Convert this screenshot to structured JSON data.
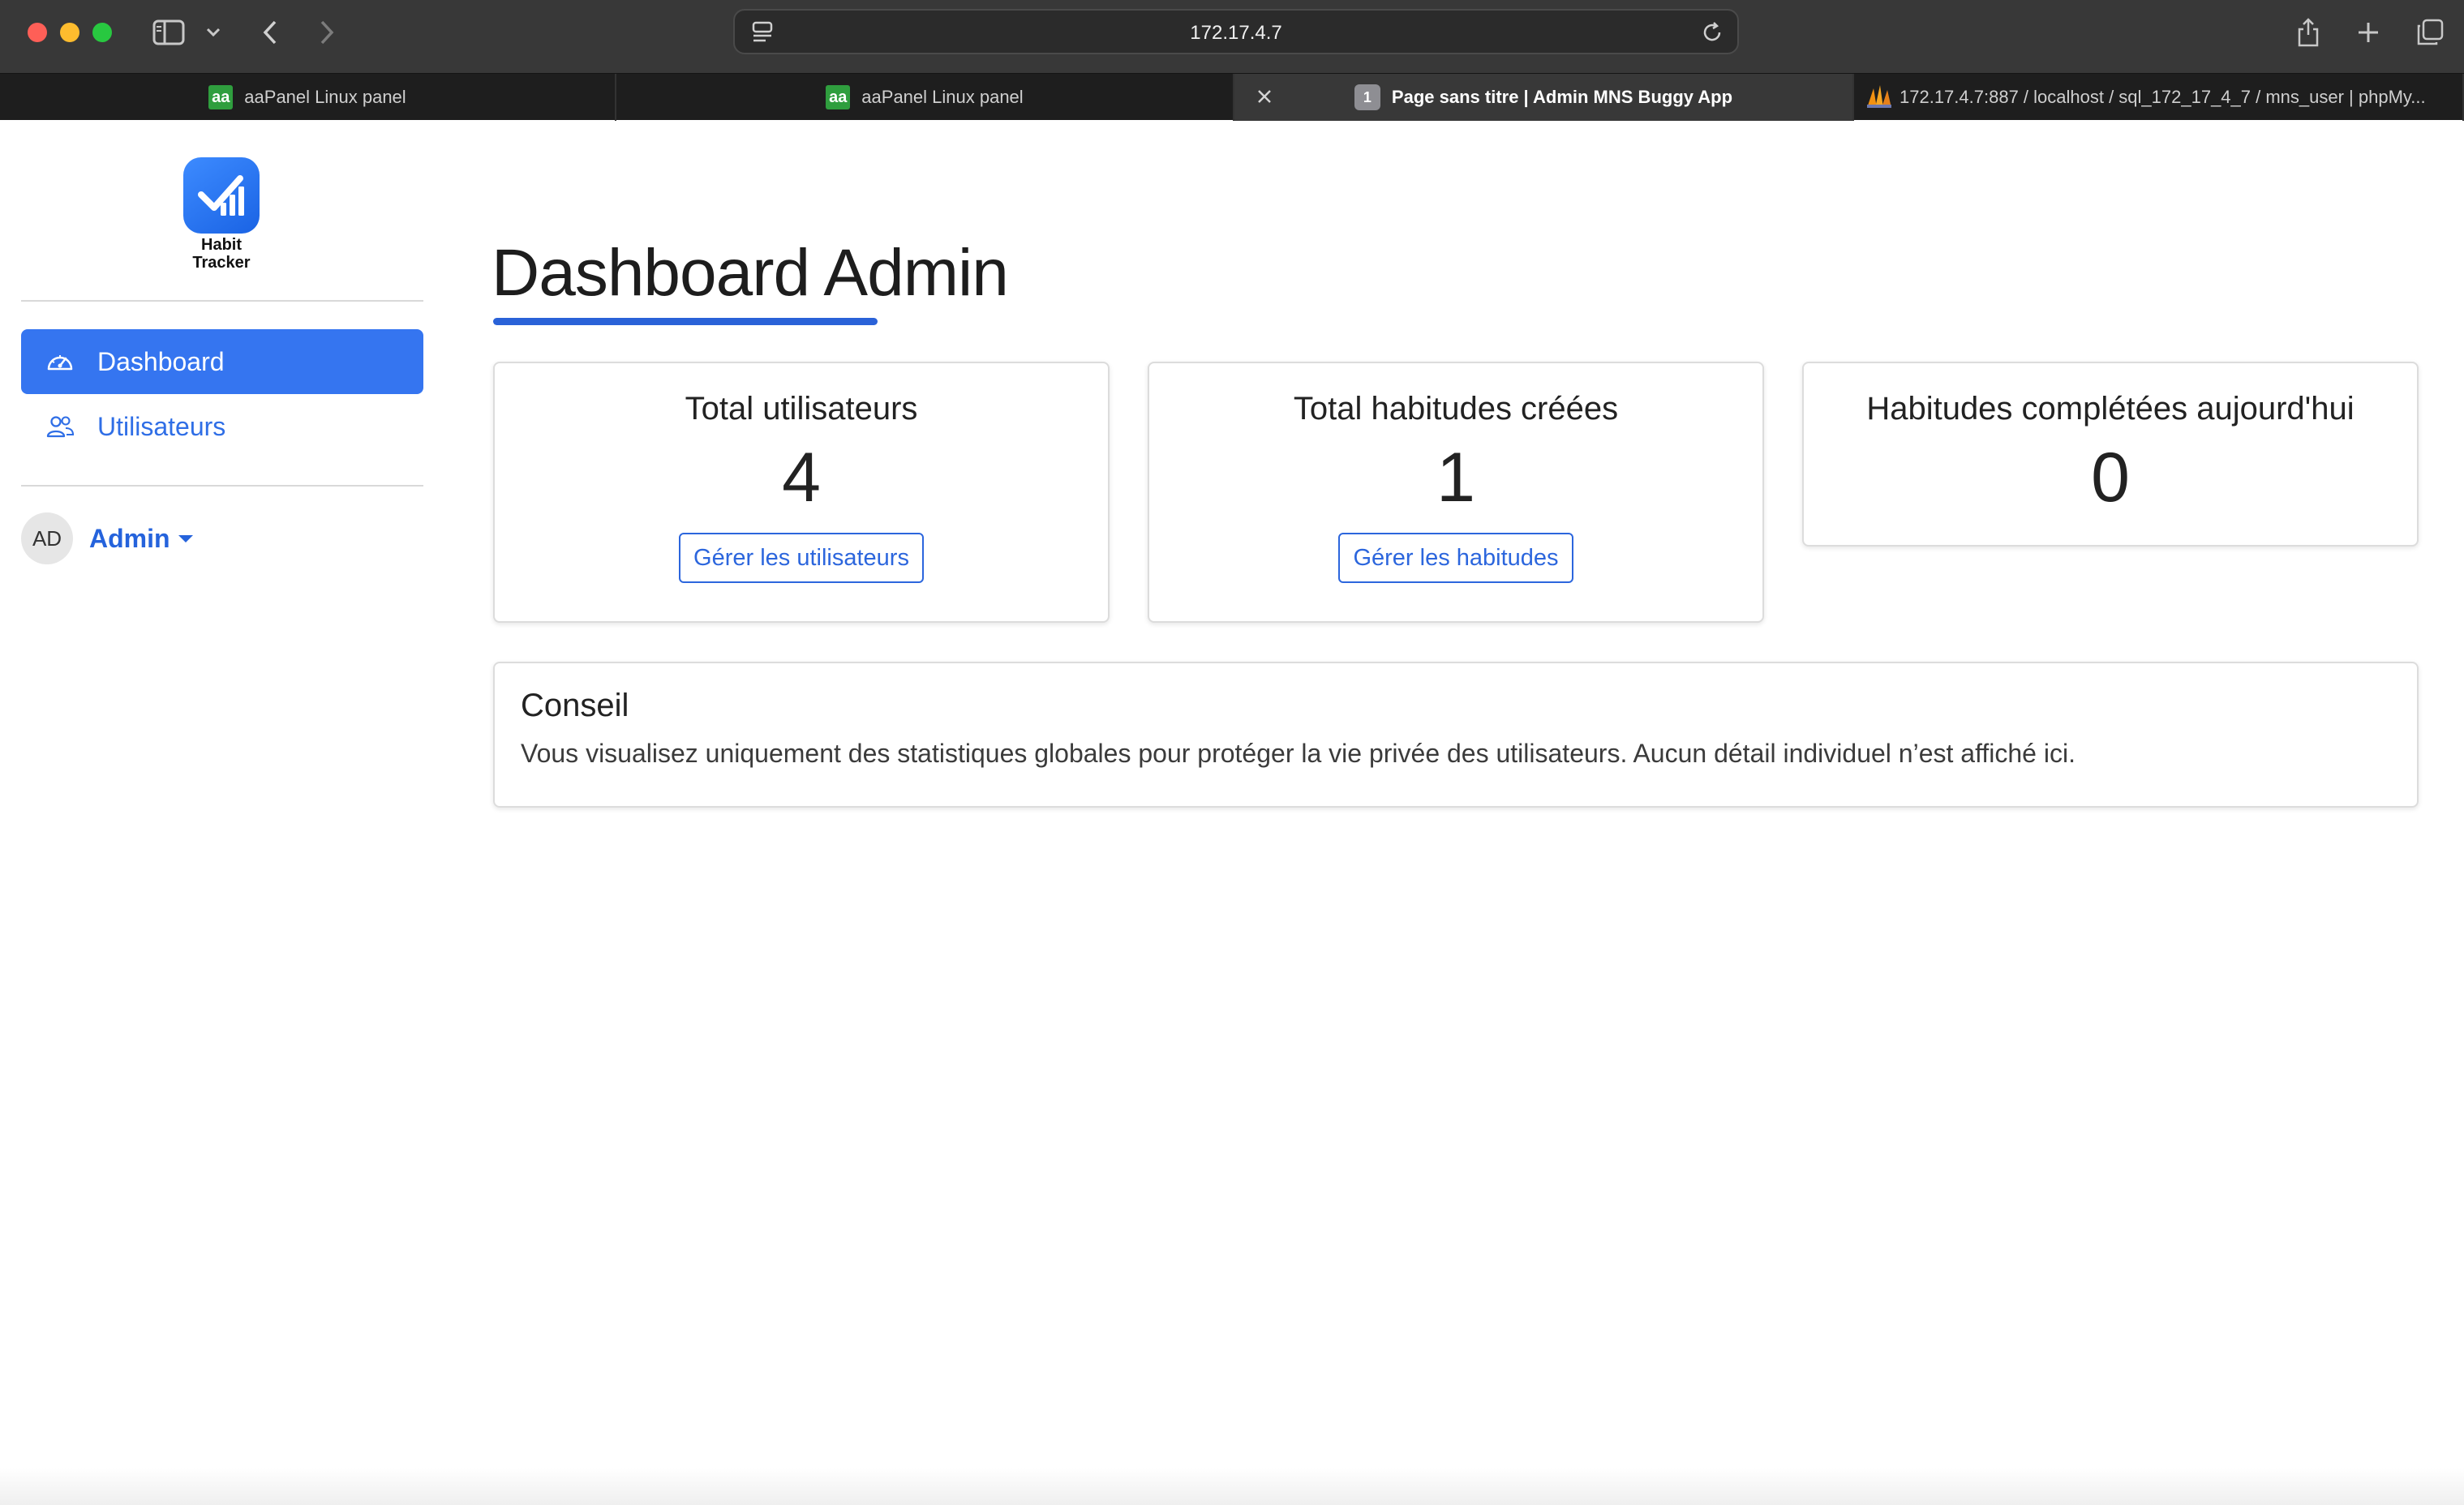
{
  "browser": {
    "address": "172.17.4.7",
    "tabs": [
      {
        "title": "aaPanel Linux panel",
        "favicon": "aa"
      },
      {
        "title": "aaPanel Linux panel",
        "favicon": "aa"
      },
      {
        "title": "Page sans titre | Admin MNS Buggy App",
        "favicon": "1",
        "active": true
      },
      {
        "title": "172.17.4.7:887 / localhost / sql_172_17_4_7 / mns_user | phpMy...",
        "favicon": "phpmyadmin-icon"
      }
    ]
  },
  "app": {
    "logo_line1": "Habit",
    "logo_line2": "Tracker",
    "accent_color": "#3575f0"
  },
  "sidebar": {
    "items": [
      {
        "label": "Dashboard",
        "icon": "speedometer-icon",
        "active": true
      },
      {
        "label": "Utilisateurs",
        "icon": "users-icon",
        "active": false
      }
    ],
    "user": {
      "initials": "AD",
      "name": "Admin"
    }
  },
  "main": {
    "title": "Dashboard Admin",
    "cards": [
      {
        "title": "Total utilisateurs",
        "value": "4",
        "button": "Gérer les utilisateurs"
      },
      {
        "title": "Total habitudes créées",
        "value": "1",
        "button": "Gérer les habitudes"
      },
      {
        "title": "Habitudes complétées aujourd'hui",
        "value": "0"
      }
    ],
    "tip": {
      "title": "Conseil",
      "body": "Vous visualisez uniquement des statistiques globales pour protéger la vie privée des utilisateurs. Aucun détail individuel n’est affiché ici."
    }
  }
}
